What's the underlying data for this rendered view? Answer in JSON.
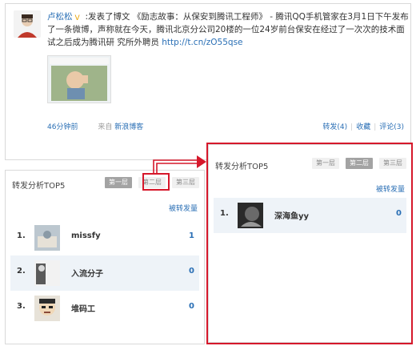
{
  "post": {
    "author": "卢松松",
    "body_prefix": ":发表了博文 《励志故事：从保安到腾讯工程师》 - 腾讯QQ手机管家在3月1日下午发布了一条微博，声称就在今天，腾讯北京分公司20楼的一位24岁前台保安在经过了一次次的技术面试之后成为腾讯研 究所外聘员 ",
    "link": "http://t.cn/zO55qse",
    "time": "46分钟前",
    "from_label": "来自",
    "source": "新浪博客",
    "actions": {
      "repost": "转发(4)",
      "favorite": "收藏",
      "comment": "评论(3)"
    }
  },
  "left_panel": {
    "title": "转发分析TOP5",
    "tabs": [
      "第一层",
      "第二层",
      "第三层"
    ],
    "sort_link": "被转发量",
    "rows": [
      {
        "rank": "1.",
        "name": "missfy",
        "count": "1"
      },
      {
        "rank": "2.",
        "name": "入流分子",
        "count": "0"
      },
      {
        "rank": "3.",
        "name": "堆码工",
        "count": "0"
      }
    ]
  },
  "right_panel": {
    "title": "转发分析TOP5",
    "tabs": [
      "第一层",
      "第二层",
      "第三层"
    ],
    "sort_link": "被转发量",
    "rows": [
      {
        "rank": "1.",
        "name": "深海鱼yy",
        "count": "0"
      }
    ]
  },
  "colors": {
    "link": "#2a6fb5",
    "highlight": "#d6182b",
    "row_alt": "#eef3f8",
    "active_tab": "#a3a3a3"
  }
}
